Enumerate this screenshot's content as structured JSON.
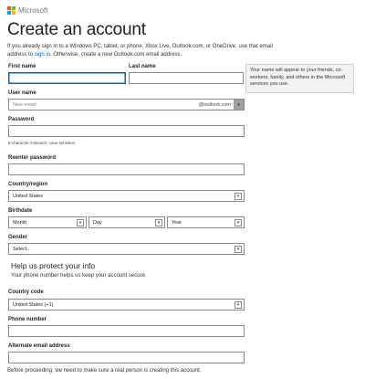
{
  "brand": {
    "name": "Microsoft",
    "colors": [
      "#f25022",
      "#7fba00",
      "#00a4ef",
      "#ffb900"
    ]
  },
  "page": {
    "title": "Create an account",
    "intro_before": "If you already sign in to a Windows PC, tablet, or phone, Xbox Live, Outlook.com, or OneDrive, use that email address to ",
    "intro_link": "sign in",
    "intro_after": ". Otherwise, create a new Outlook.com email address."
  },
  "form": {
    "first_name_label": "First name",
    "last_name_label": "Last name",
    "name_tooltip": "Your name will appear to your friends, co-workers, family, and others in the Microsoft services you use.",
    "username_label": "User name",
    "username_placeholder": "New email",
    "username_domain": "@outlook.com",
    "password_label": "Password",
    "password_hint": "8-character minimum; case sensitive",
    "reenter_password_label": "Reenter password",
    "country_label": "Country/region",
    "country_value": "United States",
    "birthdate_label": "Birthdate",
    "birth_month": "Month",
    "birth_day": "Day",
    "birth_year": "Year",
    "gender_label": "Gender",
    "gender_value": "Select..."
  },
  "protect": {
    "title": "Help us protect your info",
    "subtitle": "Your phone number helps us keep your account secure.",
    "country_code_label": "Country code",
    "country_code_value": "United States (+1)",
    "phone_label": "Phone number",
    "alt_email_label": "Alternate email address"
  },
  "footer": {
    "text": "Before proceeding, we need to make sure a real person is creating this account."
  },
  "icons": {
    "dropdown": "▾"
  }
}
